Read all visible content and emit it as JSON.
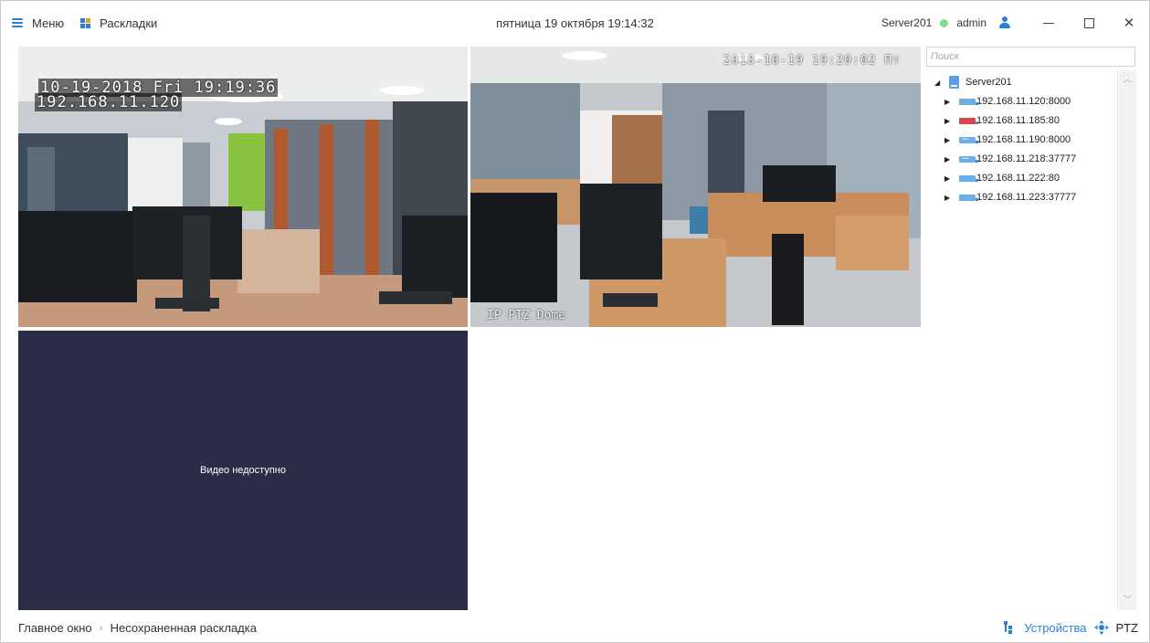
{
  "header": {
    "menu_label": "Меню",
    "layouts_label": "Раскладки",
    "datetime": "пятница 19 октября 19:14:32",
    "server_name": "Server201",
    "user_name": "admin",
    "status_color": "#86d98a"
  },
  "video": {
    "tile1": {
      "osd_datetime": "10-19-2018 Fri 19:19:36",
      "osd_ip": "192.168.11.120"
    },
    "tile2": {
      "osd_datetime": "2018-10-19 19:20:02 Пт",
      "osd_name": "IP PTZ Dome"
    },
    "tile3": {
      "message": "Видео недоступно"
    }
  },
  "sidebar": {
    "search_placeholder": "Поиск",
    "server": "Server201",
    "devices": [
      {
        "label": "192.168.11.120:8000",
        "icon": "camera-icon",
        "status": "ok"
      },
      {
        "label": "192.168.11.185:80",
        "icon": "camera-icon",
        "status": "error"
      },
      {
        "label": "192.168.11.190:8000",
        "icon": "recorder-icon",
        "status": "ok"
      },
      {
        "label": "192.168.11.218:37777",
        "icon": "recorder-icon",
        "status": "ok"
      },
      {
        "label": "192.168.11.222:80",
        "icon": "camera-icon",
        "status": "ok"
      },
      {
        "label": "192.168.11.223:37777",
        "icon": "camera-icon",
        "status": "ok"
      }
    ]
  },
  "footer": {
    "breadcrumb": [
      "Главное окно",
      "Несохраненная раскладка"
    ],
    "devices_label": "Устройства",
    "ptz_label": "PTZ",
    "accent_color": "#2c7fd6"
  }
}
